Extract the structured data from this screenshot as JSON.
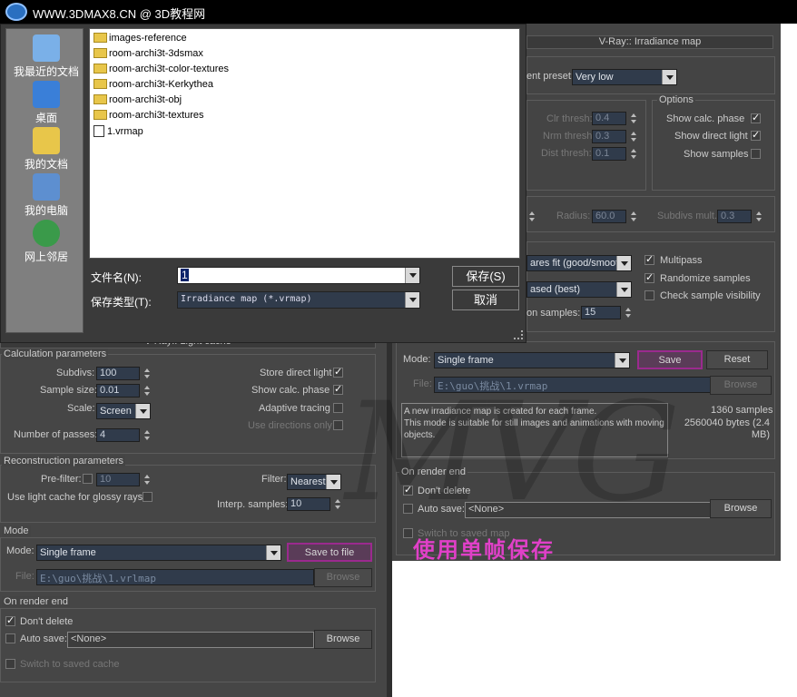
{
  "header": {
    "site_text": "WWW.3DMAX8.CN @ 3D教程网"
  },
  "save_dialog": {
    "places": [
      "我最近的文档",
      "桌面",
      "我的文档",
      "我的电脑",
      "网上邻居"
    ],
    "files": [
      {
        "name": "images-reference",
        "type": "folder"
      },
      {
        "name": "room-archi3t-3dsmax",
        "type": "folder"
      },
      {
        "name": "room-archi3t-color-textures",
        "type": "folder"
      },
      {
        "name": "room-archi3t-Kerkythea",
        "type": "folder"
      },
      {
        "name": "room-archi3t-obj",
        "type": "folder"
      },
      {
        "name": "room-archi3t-textures",
        "type": "folder"
      },
      {
        "name": "1.vrmap",
        "type": "file"
      }
    ],
    "filename_label": "文件名(N):",
    "filename_value": "1",
    "filetype_label": "保存类型(T):",
    "filetype_value": "Irradiance map (*.vrmap)",
    "save_button": "保存(S)",
    "cancel_button": "取消"
  },
  "irradiance": {
    "title": "V-Ray:: Irradiance map",
    "preset_label": "ent preset:",
    "preset_value": "Very low",
    "options_title": "Options",
    "clr_thresh_label": "Clr thresh:",
    "clr_thresh": "0.4",
    "nrm_thresh_label": "Nrm thresh:",
    "nrm_thresh": "0.3",
    "dist_thresh_label": "Dist thresh:",
    "dist_thresh": "0.1",
    "show_calc_phase": "Show calc. phase",
    "show_direct_light": "Show direct light",
    "show_samples": "Show samples",
    "radius_label": "Radius:",
    "radius": "60.0",
    "subdivs_mult_label": "Subdivs mult.",
    "subdivs_mult": "0.3",
    "interp_type": "ares fit (good/smooth",
    "lookup_type": "ased (best)",
    "calc_samples_label": "on samples:",
    "calc_samples": "15",
    "multipass": "Multipass",
    "randomize": "Randomize samples",
    "check_visibility": "Check sample visibility",
    "mode_label": "Mode:",
    "mode_value": "Single frame",
    "save_button": "Save",
    "reset_button": "Reset",
    "file_label": "File:",
    "file_value": "E:\\guo\\挑战\\1.vrmap",
    "browse_button": "Browse",
    "description": [
      "A new irradiance map is created for each frame.",
      "This mode is suitable for still images and animations with moving objects."
    ],
    "samples_count": "1360 samples",
    "bytes": "2560040 bytes (2.4 MB)",
    "on_render_end": "On render end",
    "dont_delete": "Don't delete",
    "auto_save": "Auto save:",
    "auto_save_value": "<None>",
    "browse2": "Browse",
    "switch_saved": "Switch to saved map"
  },
  "light_cache": {
    "title": "V-Ray:: Light cache",
    "calc_params": "Calculation parameters",
    "subdivs_label": "Subdivs:",
    "subdivs": "100",
    "sample_size_label": "Sample size:",
    "sample_size": "0.01",
    "scale_label": "Scale:",
    "scale": "Screen",
    "passes_label": "Number of passes:",
    "passes": "4",
    "store_direct": "Store direct light",
    "show_calc": "Show calc. phase",
    "adaptive": "Adaptive tracing",
    "use_directions": "Use directions only",
    "recon_params": "Reconstruction parameters",
    "prefilter_label": "Pre-filter:",
    "prefilter": "10",
    "glossy": "Use light cache for glossy rays",
    "filter_label": "Filter:",
    "filter": "Nearest",
    "interp_label": "Interp. samples:",
    "interp": "10",
    "mode_section": "Mode",
    "mode_label": "Mode:",
    "mode_value": "Single frame",
    "save_to_file": "Save to file",
    "file_label": "File:",
    "file_value": "E:\\guo\\挑战\\1.vrlmap",
    "browse": "Browse",
    "on_render_end": "On render end",
    "dont_delete": "Don't delete",
    "auto_save": "Auto save:",
    "auto_save_value": "<None>",
    "browse2": "Browse",
    "switch_saved": "Switch to saved cache"
  },
  "watermark": {
    "text": "MVG"
  },
  "annotation": {
    "text": "使用单帧保存"
  },
  "colors": {
    "accent_highlight": "#9b2a8e",
    "annotation": "#e040c8",
    "panel": "#444444"
  }
}
